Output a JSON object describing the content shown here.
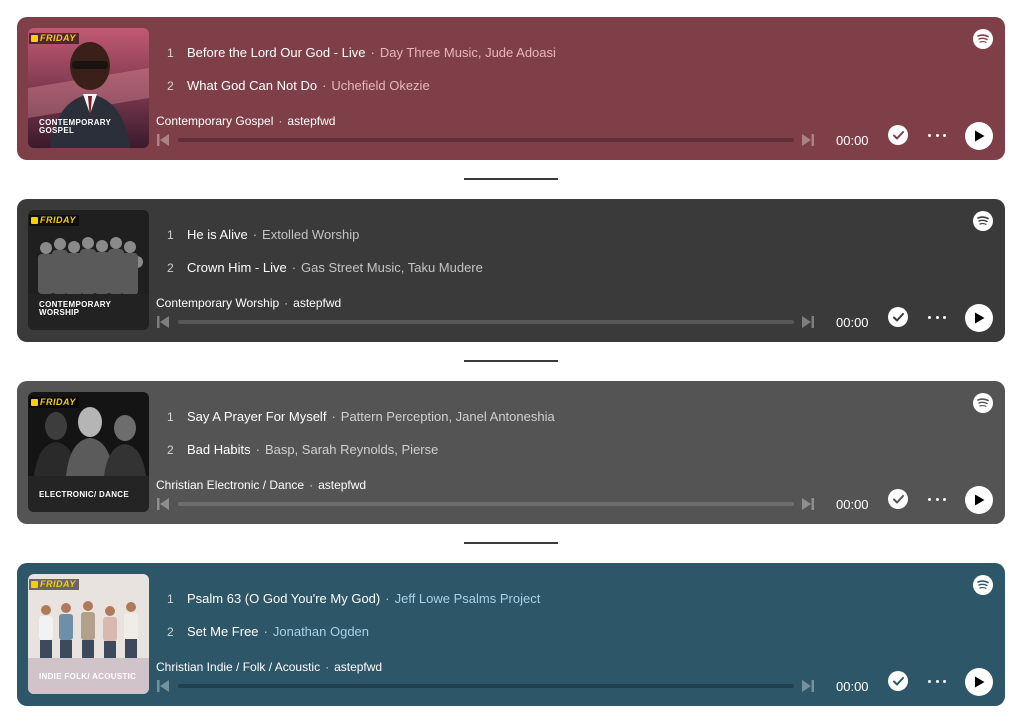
{
  "embeds": [
    {
      "color": "#7e3f48",
      "artist_color": "#e9b5bb",
      "cover_badge": "FRIDAY",
      "cover_title": "CONTEMPORARY GOSPEL",
      "tracks": [
        {
          "num": "1",
          "title": "Before the Lord Our God - Live",
          "artist": "Day Three Music, Jude Adoasi"
        },
        {
          "num": "2",
          "title": "What God Can Not Do",
          "artist": "Uchefield Okezie"
        }
      ],
      "playlist": "Contemporary Gospel",
      "owner": "astepfwd",
      "time": "00:00",
      "progress": 0
    },
    {
      "color": "#3a3a3a",
      "artist_color": "#c4c4c4",
      "cover_badge": "FRIDAY",
      "cover_title": "CONTEMPORARY WORSHIP",
      "tracks": [
        {
          "num": "1",
          "title": "He is Alive",
          "artist": "Extolled Worship"
        },
        {
          "num": "2",
          "title": "Crown Him - Live",
          "artist": "Gas Street Music, Taku Mudere"
        }
      ],
      "playlist": "Contemporary Worship",
      "owner": "astepfwd",
      "time": "00:00",
      "progress": 0
    },
    {
      "color": "#545454",
      "artist_color": "#d0d0d0",
      "cover_badge": "FRIDAY",
      "cover_title": "ELECTRONIC/ DANCE",
      "tracks": [
        {
          "num": "1",
          "title": "Say A Prayer For Myself",
          "artist": "Pattern Perception, Janel Antoneshia"
        },
        {
          "num": "2",
          "title": "Bad Habits",
          "artist": "Basp, Sarah Reynolds, Pierse"
        }
      ],
      "playlist": "Christian Electronic / Dance",
      "owner": "astepfwd",
      "time": "00:00",
      "progress": 0
    },
    {
      "color": "#2d5668",
      "artist_color": "#a7d3e6",
      "cover_badge": "FRIDAY",
      "cover_title": "INDIE FOLK/ ACOUSTIC",
      "tracks": [
        {
          "num": "1",
          "title": "Psalm 63 (O God You're My God)",
          "artist": "Jeff Lowe Psalms Project"
        },
        {
          "num": "2",
          "title": "Set Me Free",
          "artist": "Jonathan Ogden"
        }
      ],
      "playlist": "Christian Indie / Folk / Acoustic",
      "owner": "astepfwd",
      "time": "00:00",
      "progress": 0
    }
  ],
  "icons": {
    "spotify": "spotify-icon",
    "prev": "skip-previous-icon",
    "next": "skip-next-icon",
    "save": "check-icon",
    "more": "more-icon",
    "play": "play-icon"
  }
}
